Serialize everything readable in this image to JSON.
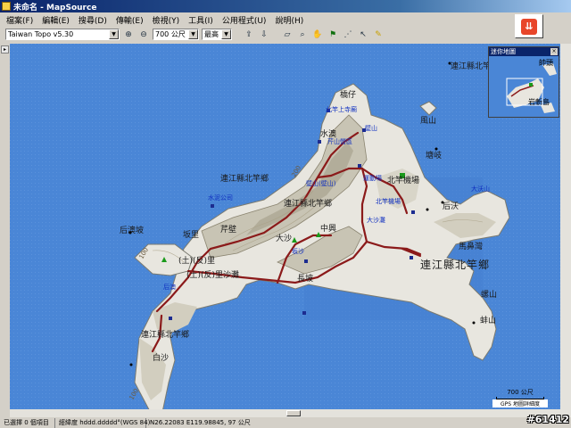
{
  "window": {
    "title": "未命名 - MapSource"
  },
  "menu": [
    "檔案(F)",
    "編輯(E)",
    "搜尋(D)",
    "傳輸(E)",
    "檢視(Y)",
    "工具(I)",
    "公用程式(U)",
    "說明(H)"
  ],
  "toolbar": {
    "map_product": "Taiwan Topo v5.30",
    "zoom_scale": "700 公尺",
    "detail_level": "最高",
    "drop_glyph": "▼",
    "icons": [
      "zoom-in-icon",
      "zoom-out-icon",
      "send-to-device-icon",
      "receive-from-device-icon",
      "select-icon",
      "zoom-tool-icon",
      "hand-icon",
      "waypoint-flag-icon",
      "route-icon",
      "pointer-icon",
      "track-pencil-icon"
    ]
  },
  "big_button": {
    "glyph": "⇊",
    "color": "#e8462a"
  },
  "left_strip_arrow": "▸",
  "map": {
    "labels": {
      "lianjiang_north_top": "連江縣北竿",
      "qiaozai": "橋仔",
      "beigan_shangwu": "北竿上寺廟",
      "shuiban": "水澳",
      "bishan_area": "壁山",
      "tower": "芹山營區",
      "fengshan": "風山",
      "tangqi": "塘岐",
      "lianjiang_beigan_mid": "連江縣北竿鄉",
      "bishan_peak": "壁山(壁山)",
      "yunchang": "運動場",
      "beigan_airport": "北竿機場",
      "lianjiang_beigan_center": "連江縣北竿鄉",
      "houao": "后澳",
      "qinbi": "芹壁",
      "banli": "坂里",
      "tu_ban_li": "(土)(反)里",
      "tu_ban_li_beach": "(土)(反)里沙灘",
      "houhu_beach": "后澳坡",
      "zhongyu": "中興",
      "bansha": "坂沙",
      "taishan": "大沙",
      "changbo": "長坡",
      "dashanbeach": "大沙灘",
      "houqiao": "后沃",
      "dawo": "大沃山",
      "majiao": "馬鼻灣",
      "lianjiang_big": "連江縣北竿鄉",
      "luoshan": "螺山",
      "gaoshan": "蚌山",
      "lianjiang_south": "連江縣北竿鄉",
      "baisha": "白沙",
      "shuigong": "水泥公司",
      "tiwan": "北竿機場",
      "contour_100a": "100",
      "contour_100b": "100",
      "contour_200": "200"
    }
  },
  "overview": {
    "title": "迷你地圖",
    "close": "×",
    "labels": [
      "帥頭",
      "岩斬島"
    ]
  },
  "scale": {
    "distance": "700 公尺",
    "source": "GPS 地圖詳細度"
  },
  "status": {
    "selection": "已選擇 0 個項目",
    "coord_format": "經緯度 hddd.ddddd°(WGS 84)",
    "position": "N26.22083 E119.98845, 97 公尺"
  },
  "watermark": "#61412"
}
